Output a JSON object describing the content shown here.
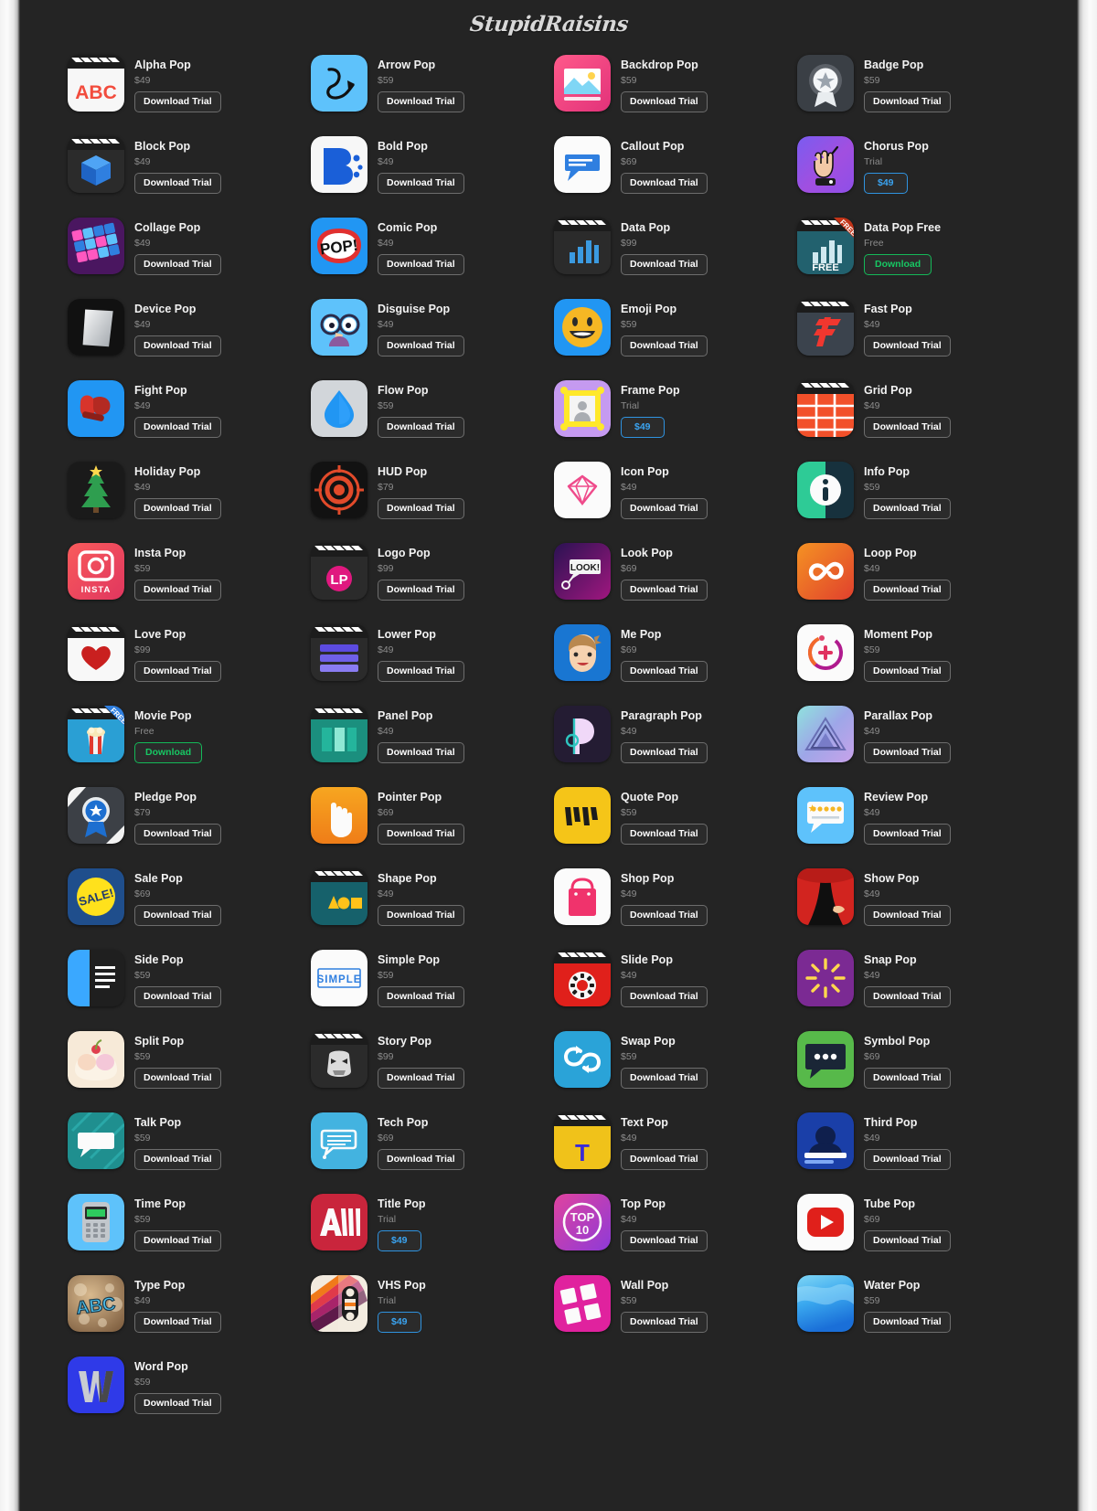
{
  "brand": {
    "name": "StupidRaisins"
  },
  "labels": {
    "download_trial": "Download Trial",
    "download": "Download",
    "trial_status": "Trial",
    "free_status": "Free"
  },
  "colors": {
    "background": "#242424",
    "text": "#f2f2f2",
    "price": "#8c8c8c",
    "button_border": "#6d6d6d",
    "free_accent": "#17c763",
    "trial_accent": "#3aa3f0"
  },
  "products": [
    {
      "name": "Alpha Pop",
      "price": "$49",
      "button": "Download Trial",
      "button_style": "default",
      "icon": "alpha-pop-icon"
    },
    {
      "name": "Arrow Pop",
      "price": "$59",
      "button": "Download Trial",
      "button_style": "default",
      "icon": "arrow-pop-icon"
    },
    {
      "name": "Backdrop Pop",
      "price": "$59",
      "button": "Download Trial",
      "button_style": "default",
      "icon": "backdrop-pop-icon"
    },
    {
      "name": "Badge Pop",
      "price": "$59",
      "button": "Download Trial",
      "button_style": "default",
      "icon": "badge-pop-icon"
    },
    {
      "name": "Block Pop",
      "price": "$49",
      "button": "Download Trial",
      "button_style": "default",
      "icon": "block-pop-icon"
    },
    {
      "name": "Bold Pop",
      "price": "$49",
      "button": "Download Trial",
      "button_style": "default",
      "icon": "bold-pop-icon"
    },
    {
      "name": "Callout Pop",
      "price": "$69",
      "button": "Download Trial",
      "button_style": "default",
      "icon": "callout-pop-icon"
    },
    {
      "name": "Chorus Pop",
      "price": "Trial",
      "button": "$49",
      "button_style": "trial",
      "icon": "chorus-pop-icon"
    },
    {
      "name": "Collage Pop",
      "price": "$49",
      "button": "Download Trial",
      "button_style": "default",
      "icon": "collage-pop-icon"
    },
    {
      "name": "Comic Pop",
      "price": "$49",
      "button": "Download Trial",
      "button_style": "default",
      "icon": "comic-pop-icon"
    },
    {
      "name": "Data Pop",
      "price": "$99",
      "button": "Download Trial",
      "button_style": "default",
      "icon": "data-pop-icon"
    },
    {
      "name": "Data Pop Free",
      "price": "Free",
      "button": "Download",
      "button_style": "free",
      "icon": "data-pop-free-icon"
    },
    {
      "name": "Device Pop",
      "price": "$49",
      "button": "Download Trial",
      "button_style": "default",
      "icon": "device-pop-icon"
    },
    {
      "name": "Disguise Pop",
      "price": "$49",
      "button": "Download Trial",
      "button_style": "default",
      "icon": "disguise-pop-icon"
    },
    {
      "name": "Emoji Pop",
      "price": "$59",
      "button": "Download Trial",
      "button_style": "default",
      "icon": "emoji-pop-icon"
    },
    {
      "name": "Fast Pop",
      "price": "$49",
      "button": "Download Trial",
      "button_style": "default",
      "icon": "fast-pop-icon"
    },
    {
      "name": "Fight Pop",
      "price": "$49",
      "button": "Download Trial",
      "button_style": "default",
      "icon": "fight-pop-icon"
    },
    {
      "name": "Flow Pop",
      "price": "$59",
      "button": "Download Trial",
      "button_style": "default",
      "icon": "flow-pop-icon"
    },
    {
      "name": "Frame Pop",
      "price": "Trial",
      "button": "$49",
      "button_style": "trial",
      "icon": "frame-pop-icon"
    },
    {
      "name": "Grid Pop",
      "price": "$49",
      "button": "Download Trial",
      "button_style": "default",
      "icon": "grid-pop-icon"
    },
    {
      "name": "Holiday Pop",
      "price": "$49",
      "button": "Download Trial",
      "button_style": "default",
      "icon": "holiday-pop-icon"
    },
    {
      "name": "HUD Pop",
      "price": "$79",
      "button": "Download Trial",
      "button_style": "default",
      "icon": "hud-pop-icon"
    },
    {
      "name": "Icon Pop",
      "price": "$49",
      "button": "Download Trial",
      "button_style": "default",
      "icon": "icon-pop-icon"
    },
    {
      "name": "Info Pop",
      "price": "$59",
      "button": "Download Trial",
      "button_style": "default",
      "icon": "info-pop-icon"
    },
    {
      "name": "Insta Pop",
      "price": "$59",
      "button": "Download Trial",
      "button_style": "default",
      "icon": "insta-pop-icon"
    },
    {
      "name": "Logo Pop",
      "price": "$99",
      "button": "Download Trial",
      "button_style": "default",
      "icon": "logo-pop-icon"
    },
    {
      "name": "Look Pop",
      "price": "$69",
      "button": "Download Trial",
      "button_style": "default",
      "icon": "look-pop-icon"
    },
    {
      "name": "Loop Pop",
      "price": "$49",
      "button": "Download Trial",
      "button_style": "default",
      "icon": "loop-pop-icon"
    },
    {
      "name": "Love Pop",
      "price": "$99",
      "button": "Download Trial",
      "button_style": "default",
      "icon": "love-pop-icon"
    },
    {
      "name": "Lower Pop",
      "price": "$49",
      "button": "Download Trial",
      "button_style": "default",
      "icon": "lower-pop-icon"
    },
    {
      "name": "Me Pop",
      "price": "$69",
      "button": "Download Trial",
      "button_style": "default",
      "icon": "me-pop-icon"
    },
    {
      "name": "Moment Pop",
      "price": "$59",
      "button": "Download Trial",
      "button_style": "default",
      "icon": "moment-pop-icon"
    },
    {
      "name": "Movie Pop",
      "price": "Free",
      "button": "Download",
      "button_style": "free",
      "icon": "movie-pop-icon"
    },
    {
      "name": "Panel Pop",
      "price": "$49",
      "button": "Download Trial",
      "button_style": "default",
      "icon": "panel-pop-icon"
    },
    {
      "name": "Paragraph Pop",
      "price": "$49",
      "button": "Download Trial",
      "button_style": "default",
      "icon": "paragraph-pop-icon"
    },
    {
      "name": "Parallax Pop",
      "price": "$49",
      "button": "Download Trial",
      "button_style": "default",
      "icon": "parallax-pop-icon"
    },
    {
      "name": "Pledge Pop",
      "price": "$79",
      "button": "Download Trial",
      "button_style": "default",
      "icon": "pledge-pop-icon"
    },
    {
      "name": "Pointer Pop",
      "price": "$69",
      "button": "Download Trial",
      "button_style": "default",
      "icon": "pointer-pop-icon"
    },
    {
      "name": "Quote Pop",
      "price": "$59",
      "button": "Download Trial",
      "button_style": "default",
      "icon": "quote-pop-icon"
    },
    {
      "name": "Review Pop",
      "price": "$49",
      "button": "Download Trial",
      "button_style": "default",
      "icon": "review-pop-icon"
    },
    {
      "name": "Sale Pop",
      "price": "$69",
      "button": "Download Trial",
      "button_style": "default",
      "icon": "sale-pop-icon"
    },
    {
      "name": "Shape Pop",
      "price": "$49",
      "button": "Download Trial",
      "button_style": "default",
      "icon": "shape-pop-icon"
    },
    {
      "name": "Shop Pop",
      "price": "$49",
      "button": "Download Trial",
      "button_style": "default",
      "icon": "shop-pop-icon"
    },
    {
      "name": "Show Pop",
      "price": "$49",
      "button": "Download Trial",
      "button_style": "default",
      "icon": "show-pop-icon"
    },
    {
      "name": "Side Pop",
      "price": "$59",
      "button": "Download Trial",
      "button_style": "default",
      "icon": "side-pop-icon"
    },
    {
      "name": "Simple Pop",
      "price": "$59",
      "button": "Download Trial",
      "button_style": "default",
      "icon": "simple-pop-icon"
    },
    {
      "name": "Slide Pop",
      "price": "$49",
      "button": "Download Trial",
      "button_style": "default",
      "icon": "slide-pop-icon"
    },
    {
      "name": "Snap Pop",
      "price": "$49",
      "button": "Download Trial",
      "button_style": "default",
      "icon": "snap-pop-icon"
    },
    {
      "name": "Split Pop",
      "price": "$59",
      "button": "Download Trial",
      "button_style": "default",
      "icon": "split-pop-icon"
    },
    {
      "name": "Story Pop",
      "price": "$99",
      "button": "Download Trial",
      "button_style": "default",
      "icon": "story-pop-icon"
    },
    {
      "name": "Swap Pop",
      "price": "$59",
      "button": "Download Trial",
      "button_style": "default",
      "icon": "swap-pop-icon"
    },
    {
      "name": "Symbol Pop",
      "price": "$69",
      "button": "Download Trial",
      "button_style": "default",
      "icon": "symbol-pop-icon"
    },
    {
      "name": "Talk Pop",
      "price": "$59",
      "button": "Download Trial",
      "button_style": "default",
      "icon": "talk-pop-icon"
    },
    {
      "name": "Tech Pop",
      "price": "$69",
      "button": "Download Trial",
      "button_style": "default",
      "icon": "tech-pop-icon"
    },
    {
      "name": "Text Pop",
      "price": "$49",
      "button": "Download Trial",
      "button_style": "default",
      "icon": "text-pop-icon"
    },
    {
      "name": "Third Pop",
      "price": "$49",
      "button": "Download Trial",
      "button_style": "default",
      "icon": "third-pop-icon"
    },
    {
      "name": "Time Pop",
      "price": "$59",
      "button": "Download Trial",
      "button_style": "default",
      "icon": "time-pop-icon"
    },
    {
      "name": "Title Pop",
      "price": "Trial",
      "button": "$49",
      "button_style": "trial",
      "icon": "title-pop-icon"
    },
    {
      "name": "Top Pop",
      "price": "$49",
      "button": "Download Trial",
      "button_style": "default",
      "icon": "top-pop-icon"
    },
    {
      "name": "Tube Pop",
      "price": "$69",
      "button": "Download Trial",
      "button_style": "default",
      "icon": "tube-pop-icon"
    },
    {
      "name": "Type Pop",
      "price": "$49",
      "button": "Download Trial",
      "button_style": "default",
      "icon": "type-pop-icon"
    },
    {
      "name": "VHS Pop",
      "price": "Trial",
      "button": "$49",
      "button_style": "trial",
      "icon": "vhs-pop-icon"
    },
    {
      "name": "Wall Pop",
      "price": "$59",
      "button": "Download Trial",
      "button_style": "default",
      "icon": "wall-pop-icon"
    },
    {
      "name": "Water Pop",
      "price": "$59",
      "button": "Download Trial",
      "button_style": "default",
      "icon": "water-pop-icon"
    },
    {
      "name": "Word Pop",
      "price": "$59",
      "button": "Download Trial",
      "button_style": "default",
      "icon": "word-pop-icon"
    }
  ]
}
